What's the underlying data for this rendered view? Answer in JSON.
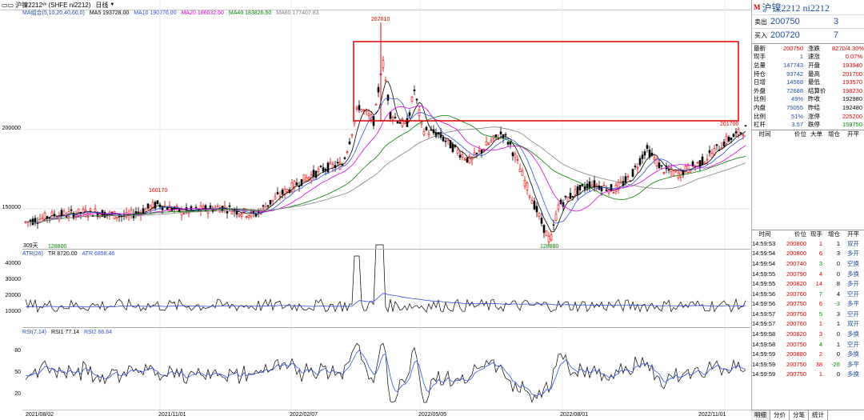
{
  "titlebar": {
    "symbol": "沪镍2212",
    "sup": "##",
    "code": "(SHFE ni2212)",
    "period": "日线",
    "period_arrow": "▼"
  },
  "ma_legend": {
    "name": "MA组合(5,10,20,40,60,0)",
    "ma5": "MA5 193728.00",
    "ma10": "MA10 190276.00",
    "ma20": "MA20 186032.50",
    "ma40": "MA40 183826.50",
    "ma60": "MA60 177407.83"
  },
  "atr_legend": {
    "name": "ATR(26)",
    "tr": "TR 8720.00",
    "atr": "ATR 6858.46"
  },
  "rsi_legend": {
    "name": "RSI(7,14)",
    "rsi1": "RSI1 77.14",
    "rsi2": "RSI2 66.64"
  },
  "axis": {
    "main": [
      "200000",
      "150000"
    ],
    "atr": [
      "40000",
      "30000",
      "20000",
      "10000"
    ],
    "rsi": [
      "80",
      "50",
      "20"
    ],
    "days_label": "309天"
  },
  "annotations": {
    "high": "267610",
    "low": "128880",
    "left_high": "160170",
    "left_low": "128800",
    "last": "201700"
  },
  "dates": [
    "2021/08/02",
    "2021/11/01",
    "2022/02/07",
    "2022/05/05",
    "2022/08/01",
    "2022/11/01"
  ],
  "colors": {
    "up": "#e00000",
    "down": "#000000",
    "ma5": "#000000",
    "ma10": "#3050e0",
    "ma20": "#e000e0",
    "ma40": "#008000",
    "ma60": "#808080",
    "box": "#e00000"
  },
  "panel": {
    "title": "沪镍2212 ni2212",
    "m_icon": "M",
    "sell_label": "卖出",
    "sell_price": "200750",
    "sell_vol": "3",
    "buy_label": "买入",
    "buy_price": "200720",
    "buy_vol": "7",
    "quote": [
      {
        "k1": "最新",
        "v1": "200750",
        "c1": "red",
        "k2": "涨跌",
        "v2": "8270/4.30%",
        "c2": "red"
      },
      {
        "k1": "现手",
        "v1": "1",
        "c1": "blue",
        "k2": "速涨",
        "v2": "0.07%",
        "c2": "red"
      },
      {
        "k1": "总量",
        "v1": "147743",
        "c1": "blue",
        "k2": "开盘",
        "v2": "193940",
        "c2": "red"
      },
      {
        "k1": "持仓",
        "v1": "93742",
        "c1": "blue",
        "k2": "最高",
        "v2": "201700",
        "c2": "red"
      },
      {
        "k1": "日增",
        "v1": "14568",
        "c1": "blue",
        "k2": "最低",
        "v2": "193570",
        "c2": "red"
      },
      {
        "k1": "外盘",
        "v1": "72688",
        "c1": "blue",
        "k2": "结算价",
        "v2": "198230",
        "c2": "red"
      },
      {
        "k1": "比例",
        "v1": "49%",
        "c1": "blue",
        "k2": "昨收",
        "v2": "192980",
        "c2": ""
      },
      {
        "k1": "内盘",
        "v1": "75055",
        "c1": "blue",
        "k2": "昨结",
        "v2": "192480",
        "c2": ""
      },
      {
        "k1": "比例",
        "v1": "51%",
        "c1": "blue",
        "k2": "涨停",
        "v2": "225200",
        "c2": "red"
      },
      {
        "k1": "杠杆",
        "v1": "3.57",
        "c1": "blue",
        "k2": "跌停",
        "v2": "159750",
        "c2": "green"
      }
    ],
    "mid_header": [
      "时间",
      "价位",
      "大单",
      "增仓",
      "开平"
    ],
    "tick_header": [
      "时间",
      "价位",
      "现手",
      "增仓",
      "开平"
    ],
    "ticks": [
      {
        "t": "14:59:53",
        "p": "200800",
        "q": "1",
        "oi": "1",
        "type": "双开"
      },
      {
        "t": "14:59:54",
        "p": "200800",
        "q": "6",
        "oi": "3",
        "type": "多开"
      },
      {
        "t": "14:59:54",
        "p": "200740",
        "q": "3",
        "oi": "0",
        "type": "空换"
      },
      {
        "t": "14:59:55",
        "p": "200790",
        "q": "4",
        "oi": "0",
        "type": "多换"
      },
      {
        "t": "14:59:55",
        "p": "200820",
        "q": "14",
        "oi": "8",
        "type": "多开"
      },
      {
        "t": "14:59:56",
        "p": "200760",
        "q": "7",
        "oi": "4",
        "type": "空开"
      },
      {
        "t": "14:59:56",
        "p": "200750",
        "q": "6",
        "oi": "-3",
        "type": "多平"
      },
      {
        "t": "14:59:57",
        "p": "200750",
        "q": "5",
        "oi": "3",
        "type": "空开"
      },
      {
        "t": "14:59:57",
        "p": "200760",
        "q": "1",
        "oi": "1",
        "type": "双开"
      },
      {
        "t": "14:59:58",
        "p": "200820",
        "q": "3",
        "oi": "0",
        "type": "多换"
      },
      {
        "t": "14:59:58",
        "p": "200750",
        "q": "4",
        "oi": "1",
        "type": "空开"
      },
      {
        "t": "14:59:59",
        "p": "200880",
        "q": "2",
        "oi": "0",
        "type": "多换"
      },
      {
        "t": "14:59:59",
        "p": "200750",
        "q": "38",
        "oi": "-26",
        "type": "多平"
      },
      {
        "t": "14:59:59",
        "p": "200750",
        "q": "1",
        "oi": "0",
        "type": "多换"
      }
    ],
    "tabs": [
      "明细",
      "分价",
      "分笔",
      "统计"
    ]
  }
}
